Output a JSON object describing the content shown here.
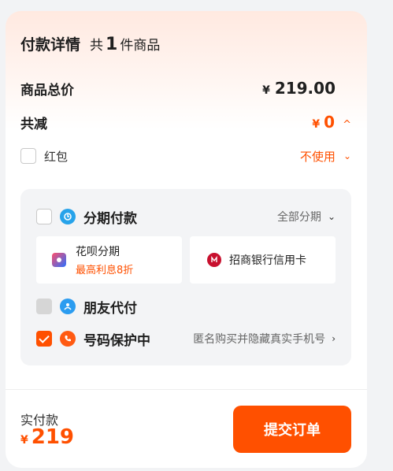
{
  "header": {
    "title": "付款详情",
    "gong": "共",
    "count": "1",
    "suffix": "件商品"
  },
  "total": {
    "label": "商品总价",
    "currency": "¥",
    "value": "219.00"
  },
  "reduce": {
    "label": "共减",
    "currency": "¥",
    "value": "0",
    "caret": "^"
  },
  "hongbao": {
    "label": "红包",
    "action": "不使用",
    "caret": "⌄"
  },
  "payment": {
    "fenqi": {
      "label": "分期付款",
      "extra": "全部分期",
      "caret": "⌄"
    },
    "huabei": {
      "title": "花呗分期",
      "subtitle": "最高利息8折"
    },
    "cmb": {
      "title": "招商银行信用卡"
    },
    "friend": {
      "label": "朋友代付"
    },
    "protect": {
      "label": "号码保护中",
      "extra": "匿名购买并隐藏真实手机号",
      "caret": "›"
    }
  },
  "footer": {
    "pay_label": "实付款",
    "currency": "¥",
    "amount": "219",
    "submit": "提交订单"
  },
  "colors": {
    "accent": "#ff5000",
    "panel": "#f3f4f6"
  }
}
